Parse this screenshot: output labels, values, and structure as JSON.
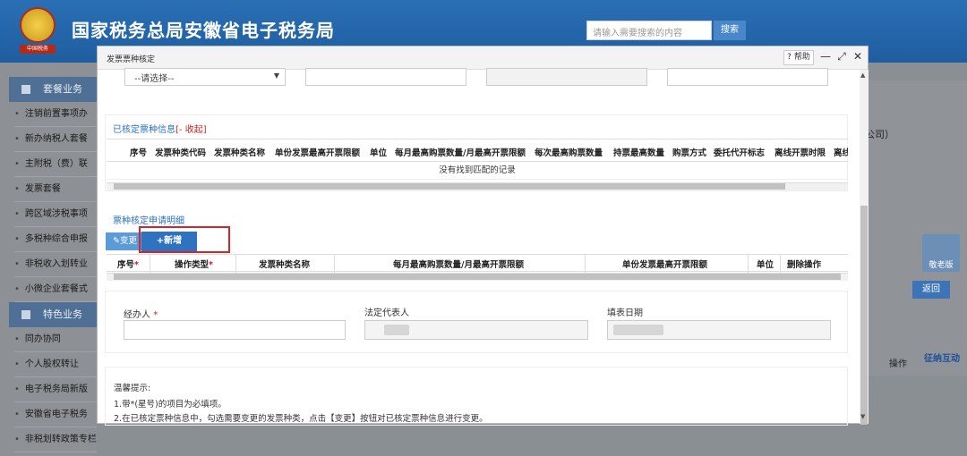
{
  "header": {
    "site_title": "国家税务总局安徽省电子税务局",
    "search_placeholder": "请输入需要搜索的内容",
    "search_button": "搜索",
    "emblem_caption": "中国税务"
  },
  "sidebar": {
    "sections": [
      {
        "label": "套餐业务",
        "items": [
          "注销前置事项办",
          "新办纳税人套餐",
          "主附税（费）联",
          "发票套餐",
          "跨区域涉税事项",
          "多税种综合申报",
          "非税收入划转业",
          "小微企业套餐式"
        ]
      },
      {
        "label": "特色业务",
        "items": [
          "同办协同",
          "个人股权转让",
          "电子税务局新版",
          "安徽省电子税务",
          "非税划转政策专栏"
        ]
      }
    ]
  },
  "background": {
    "partial_text": "公司）",
    "return_button": "返回",
    "operation_label": "操作",
    "float_button": "敬老版",
    "avatar_text": "征纳互动"
  },
  "modal": {
    "title": "发票票种核定",
    "help_label": "帮助",
    "select_placeholder": "--请选择--",
    "section1": {
      "title": "已核定票种信息",
      "collapse": "[- 收起]",
      "columns": [
        "序号",
        "发票种类代码",
        "发票种类名称",
        "单份发票最高开票限额",
        "单位",
        "每月最高购票数量/月最高开票限额",
        "每次最高购票数量",
        "持票最高数量",
        "购票方式",
        "委托代开标志",
        "离线开票时限",
        "离线"
      ],
      "empty_message": "没有找到匹配的记录"
    },
    "section2": {
      "title": "票种核定申请明细",
      "change_button": "变更",
      "add_button": "+新增",
      "columns": [
        "序号",
        "操作类型",
        "发票种类名称",
        "每月最高购票数量/月最高开票限额",
        "单份发票最高开票限额",
        "单位",
        "删除操作"
      ]
    },
    "section3": {
      "handler_label": "经办人",
      "legal_rep_label": "法定代表人",
      "fill_date_label": "填表日期"
    },
    "tips": {
      "title": "温馨提示:",
      "lines": [
        "1.带*(星号)的项目为必填项。",
        "2.在已核定票种信息中，勾选需要变更的发票种类，点击【变更】按钮对已核定票种信息进行变更。"
      ]
    }
  },
  "colors": {
    "header": "#2a6fb4",
    "primary_button": "#2f73c0",
    "highlight": "#d8232a",
    "section_title": "#2b72c0"
  }
}
